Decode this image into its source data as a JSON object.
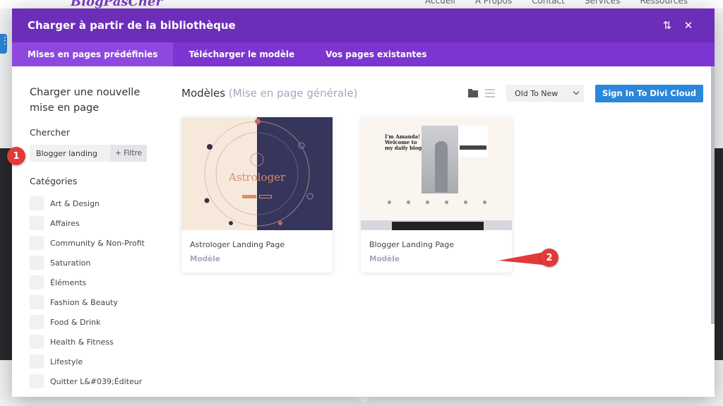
{
  "background": {
    "logo": "BlogPasCher",
    "nav": [
      "Accueil",
      "A Propos",
      "Contact",
      "Services",
      "Ressources"
    ]
  },
  "modal": {
    "title": "Charger à partir de la bibliothèque",
    "tabs": [
      {
        "label": "Mises en pages prédéfinies",
        "active": true
      },
      {
        "label": "Télécharger le modèle",
        "active": false
      },
      {
        "label": "Vos pages existantes",
        "active": false
      }
    ]
  },
  "sidebar": {
    "title": "Charger une nouvelle mise en page",
    "search_label": "Chercher",
    "search_value": "Blogger landing",
    "filter_label": "+ Filtre",
    "categories_label": "Catégories",
    "categories": [
      "Art & Design",
      "Affaires",
      "Community & Non-Profit",
      "Saturation",
      "Éléments",
      "Fashion & Beauty",
      "Food & Drink",
      "Health & Fitness",
      "Lifestyle",
      "Quitter L&#039;Éditeur"
    ]
  },
  "main": {
    "title": "Modèles",
    "subtitle": "(Mise en page générale)",
    "sort_value": "Old To New",
    "cloud_button": "Sign In To Divi Cloud",
    "cards": [
      {
        "name": "Astrologer Landing Page",
        "type": "Modèle",
        "thumb_title": "Astrologer"
      },
      {
        "name": "Blogger Landing Page",
        "type": "Modèle",
        "thumb_text": "I'm Amanda! Welcome to my daily blog"
      }
    ]
  },
  "annotations": [
    "1",
    "2"
  ],
  "colors": {
    "header": "#6c2eb9",
    "tabs": "#7d35d1",
    "active_tab": "#8e48e0",
    "cloud_button": "#2b87da",
    "badge": "#e23a3a"
  }
}
